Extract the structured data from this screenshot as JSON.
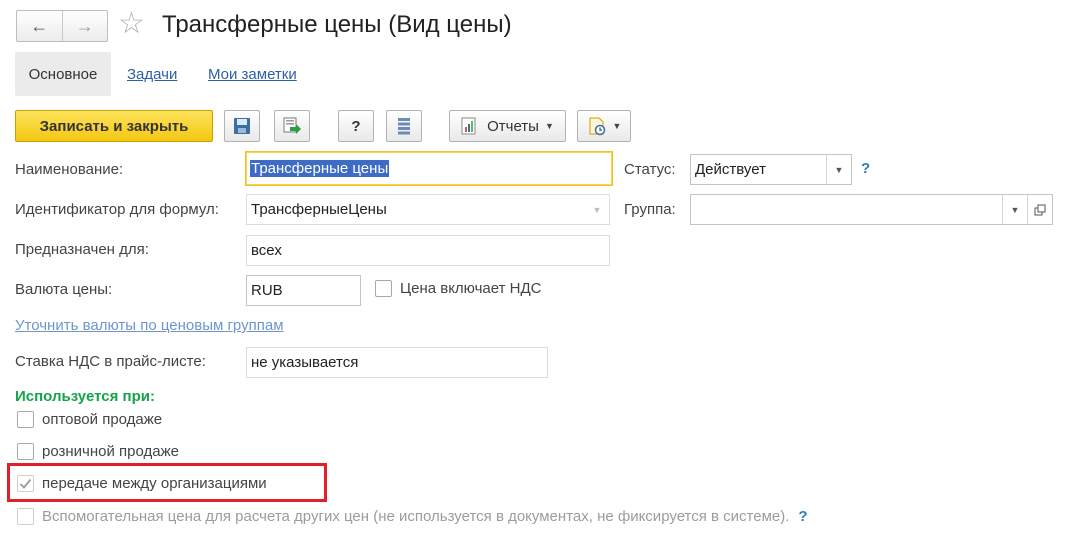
{
  "window": {
    "title": "Трансферные цены (Вид цены)",
    "back_icon": "←",
    "forward_icon": "→",
    "star_icon": "☆"
  },
  "tabs": {
    "main": "Основное",
    "tasks": "Задачи",
    "notes": "Мои заметки"
  },
  "toolbar": {
    "save_close": "Записать и закрыть",
    "help": "?",
    "reports": "Отчеты"
  },
  "form": {
    "name_label": "Наименование:",
    "name_value": "Трансферные цены",
    "status_label": "Статус:",
    "status_value": "Действует",
    "status_help": "?",
    "formula_id_label": "Идентификатор для формул:",
    "formula_id_value": "ТрансферныеЦены",
    "group_label": "Группа:",
    "group_value": "",
    "purpose_label": "Предназначен для:",
    "purpose_value": "всех",
    "currency_label": "Валюта цены:",
    "currency_value": "RUB",
    "vat_included_label": "Цена включает НДС",
    "refine_currency_link": "Уточнить валюты по ценовым группам",
    "vat_rate_label": "Ставка НДС в прайс-листе:",
    "vat_rate_value": "не указывается"
  },
  "usage": {
    "heading": "Используется при:",
    "wholesale": "оптовой продаже",
    "retail": "розничной продаже",
    "transfer": "передаче между организациями",
    "auxiliary": "Вспомогательная цена для расчета других цен (не используется в документах, не фиксируется в системе).",
    "auxiliary_help": "?"
  },
  "colors": {
    "accent_yellow": "#f4c712",
    "highlight_red": "#e3202a",
    "section_green": "#16a34a",
    "link_blue": "#2d5fa8"
  }
}
